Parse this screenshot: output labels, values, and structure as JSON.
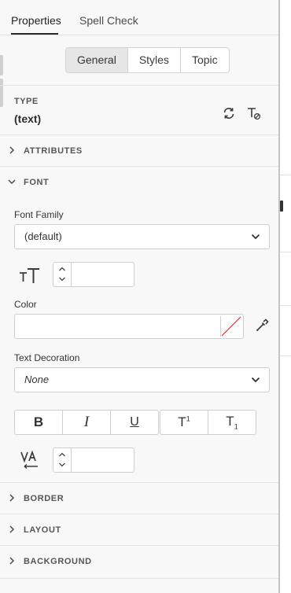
{
  "tabs": [
    {
      "label": "Properties",
      "active": true
    },
    {
      "label": "Spell Check",
      "active": false
    }
  ],
  "segmented": [
    {
      "label": "General",
      "selected": true
    },
    {
      "label": "Styles",
      "selected": false
    },
    {
      "label": "Topic",
      "selected": false
    }
  ],
  "type": {
    "label": "TYPE",
    "value": "(text)",
    "icons": [
      "refresh-icon",
      "clear-format-icon"
    ]
  },
  "sections": {
    "attributes": {
      "label": "ATTRIBUTES",
      "expanded": false
    },
    "font": {
      "label": "FONT",
      "expanded": true
    },
    "border": {
      "label": "BORDER",
      "expanded": false
    },
    "layout": {
      "label": "LAYOUT",
      "expanded": false
    },
    "background": {
      "label": "BACKGROUND",
      "expanded": false
    }
  },
  "font": {
    "family_label": "Font Family",
    "family_value": "(default)",
    "size_value": "",
    "color_label": "Color",
    "color_value": "",
    "decoration_label": "Text Decoration",
    "decoration_value": "None",
    "format_buttons": [
      {
        "icon": "bold-icon",
        "glyph": "B"
      },
      {
        "icon": "italic-icon",
        "glyph": "I"
      },
      {
        "icon": "underline-icon",
        "glyph": "U"
      },
      {
        "icon": "superscript-icon",
        "glyph": "T"
      },
      {
        "icon": "subscript-icon",
        "glyph": "T"
      }
    ],
    "letter_spacing_value": ""
  },
  "colors": {
    "accent_line": "#2c2c2c",
    "no_color_slash": "#d7373f"
  }
}
